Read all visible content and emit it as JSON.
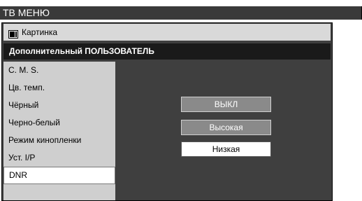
{
  "title_bar": {
    "label": "ТВ МЕНЮ"
  },
  "picture_row": {
    "label": "Картинка",
    "icon": "picture-icon"
  },
  "section_header": {
    "label": "Дополнительный ПОЛЬЗОВАТЕЛЬ"
  },
  "menu": {
    "items": [
      {
        "label": "C. M. S."
      },
      {
        "label": "Цв. темп."
      },
      {
        "label": "Чёрный"
      },
      {
        "label": "Черно-белый"
      },
      {
        "label": "Режим киноплeнки"
      },
      {
        "label": "Уст. I/P"
      },
      {
        "label": "DNR"
      }
    ],
    "selected": "DNR"
  },
  "options": {
    "items": [
      {
        "label": "ВЫКЛ"
      },
      {
        "label": "Высокая"
      },
      {
        "label": "Низкая"
      }
    ],
    "selected": "Низкая"
  },
  "colors": {
    "title_bar_bg": "#3a3a3a",
    "panel_bg": "#3f3f3f",
    "list_bg": "#cfcfcf",
    "selected_bg": "#ffffff",
    "option_bg": "#8a8a8a"
  }
}
